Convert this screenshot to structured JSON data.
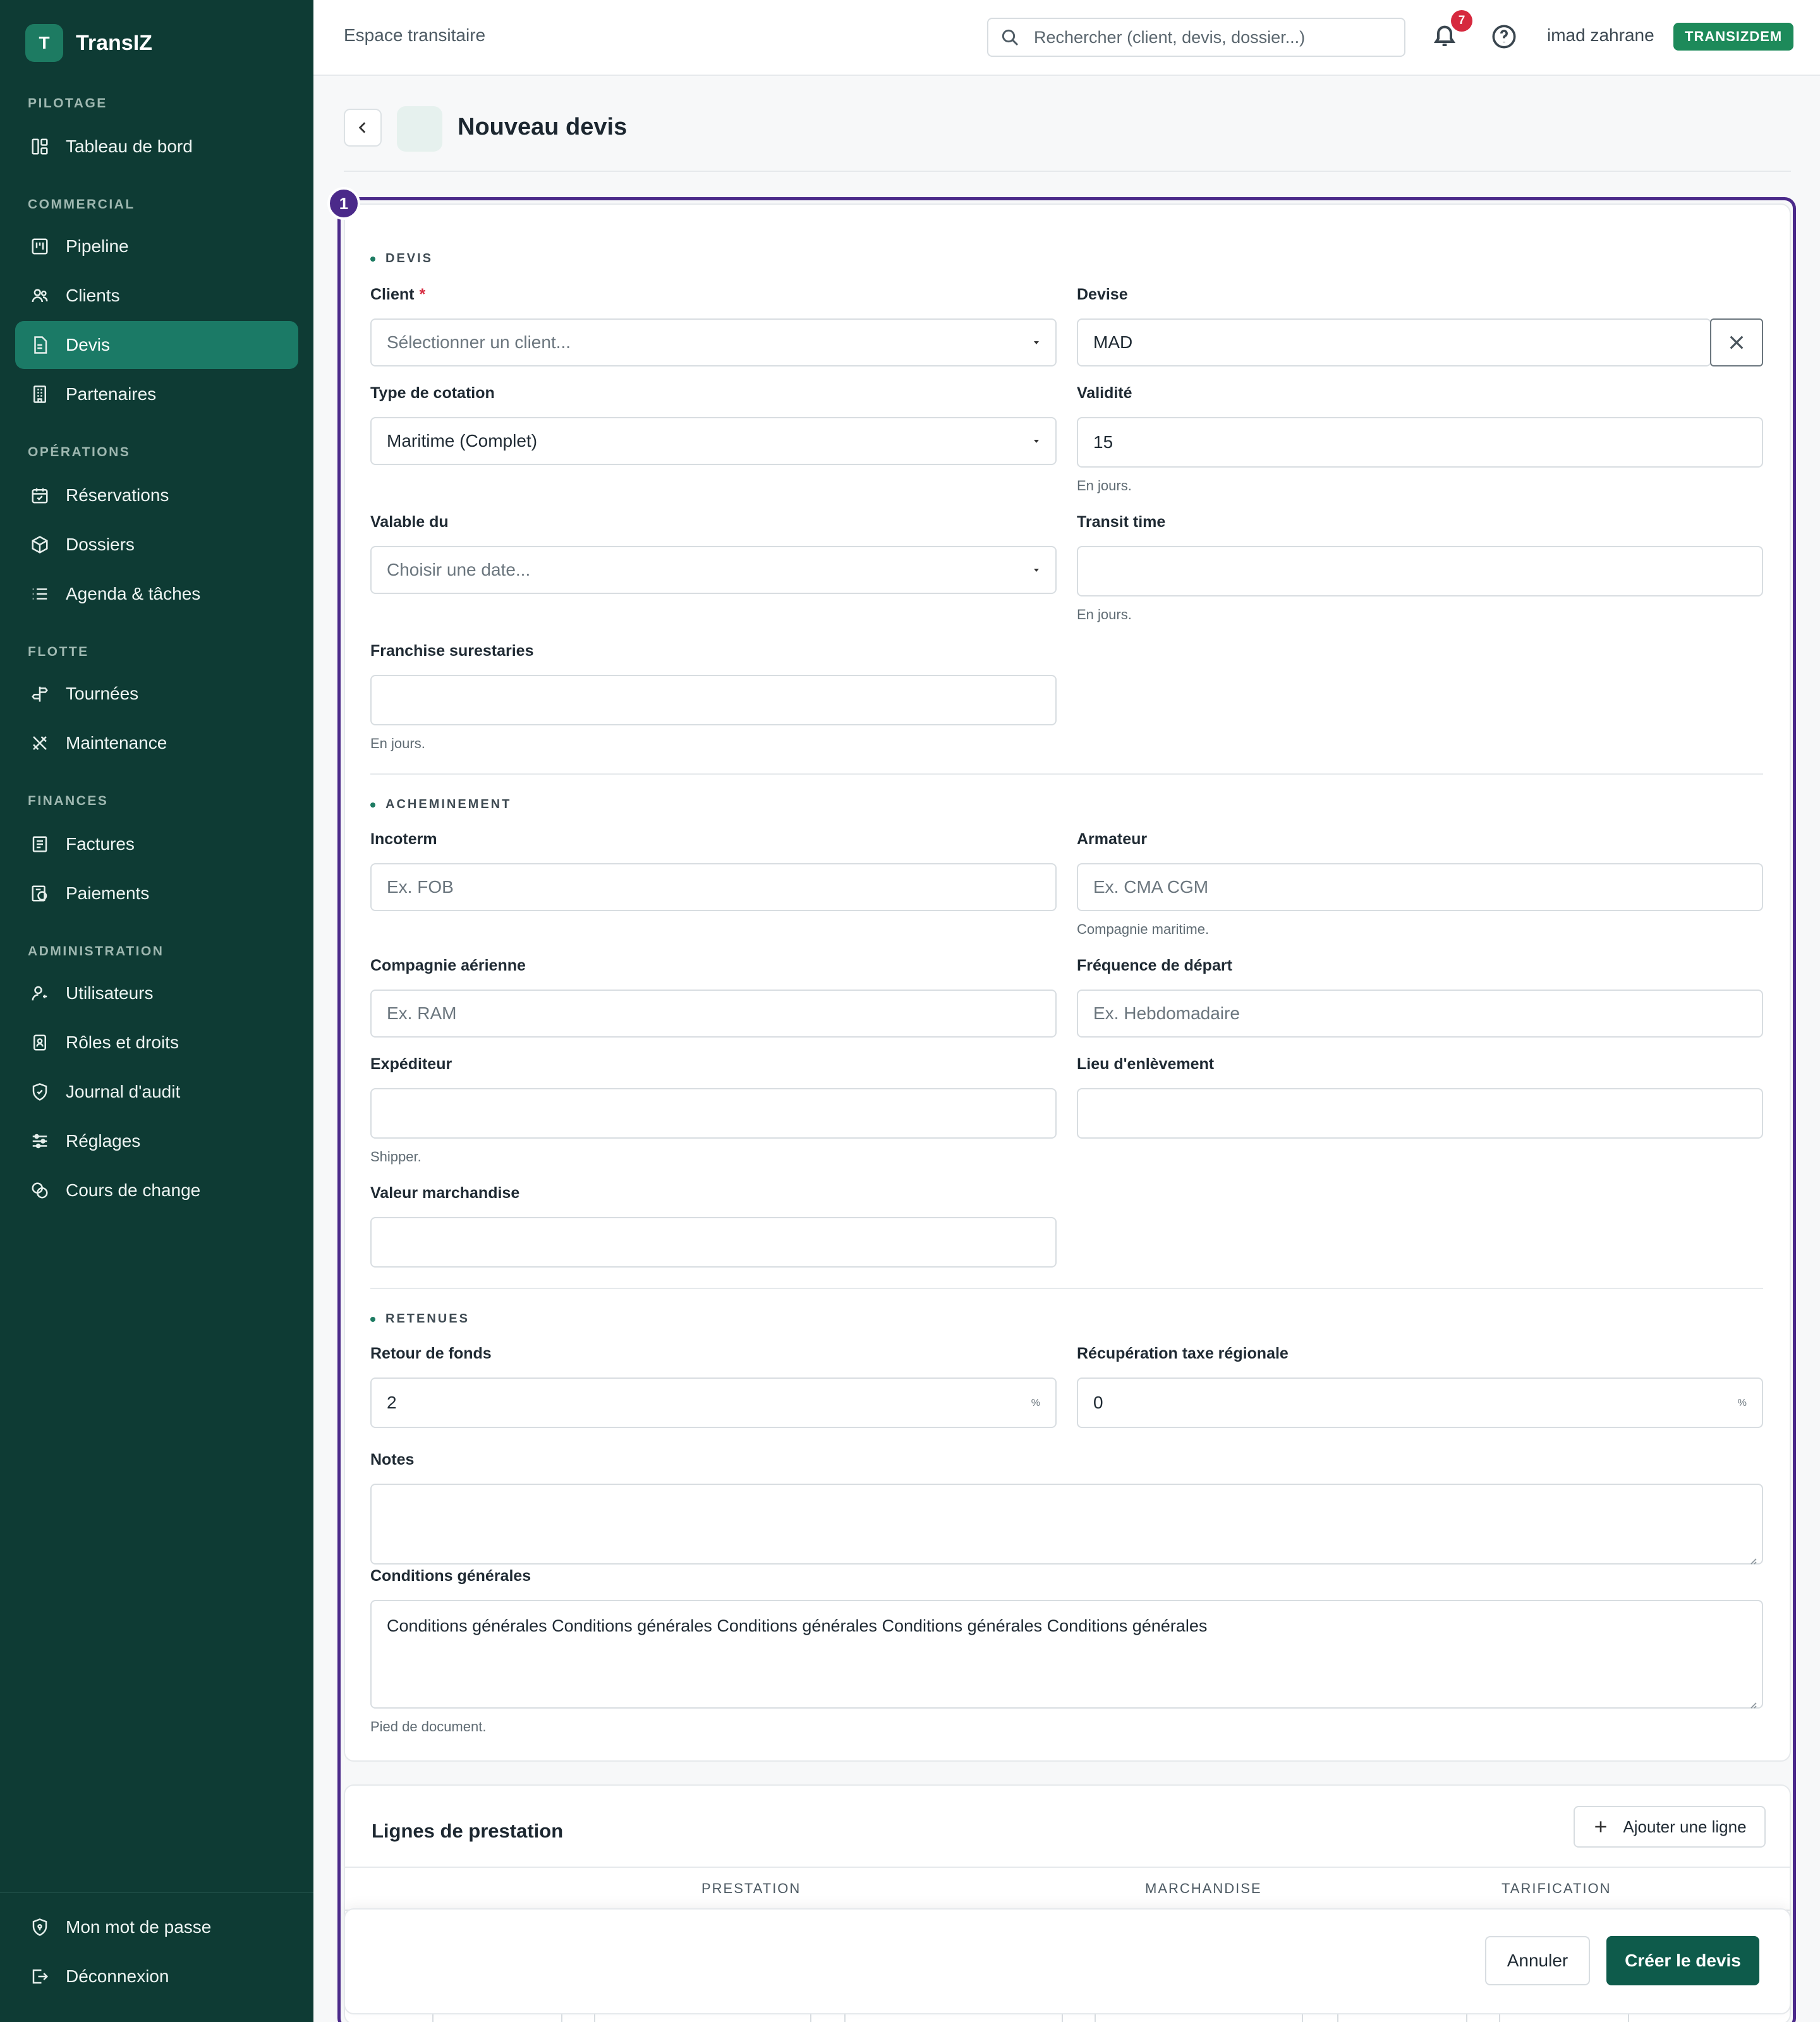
{
  "brand": {
    "initial": "T",
    "name": "TransIZ"
  },
  "sidebar": {
    "sections": [
      {
        "title": "PILOTAGE",
        "items": [
          {
            "label": "Tableau de bord",
            "icon": "dashboard-icon"
          }
        ]
      },
      {
        "title": "COMMERCIAL",
        "items": [
          {
            "label": "Pipeline",
            "icon": "pipeline-icon"
          },
          {
            "label": "Clients",
            "icon": "users-icon"
          },
          {
            "label": "Devis",
            "icon": "file-icon",
            "active": true
          },
          {
            "label": "Partenaires",
            "icon": "building-icon"
          }
        ]
      },
      {
        "title": "OPÉRATIONS",
        "items": [
          {
            "label": "Réservations",
            "icon": "calendar-check-icon"
          },
          {
            "label": "Dossiers",
            "icon": "package-icon"
          },
          {
            "label": "Agenda & tâches",
            "icon": "list-icon"
          }
        ]
      },
      {
        "title": "FLOTTE",
        "items": [
          {
            "label": "Tournées",
            "icon": "signpost-icon"
          },
          {
            "label": "Maintenance",
            "icon": "tools-icon"
          }
        ]
      },
      {
        "title": "FINANCES",
        "items": [
          {
            "label": "Factures",
            "icon": "invoice-icon"
          },
          {
            "label": "Paiements",
            "icon": "payment-icon"
          }
        ]
      },
      {
        "title": "ADMINISTRATION",
        "items": [
          {
            "label": "Utilisateurs",
            "icon": "user-key-icon"
          },
          {
            "label": "Rôles et droits",
            "icon": "badge-icon"
          },
          {
            "label": "Journal d'audit",
            "icon": "shield-icon"
          },
          {
            "label": "Réglages",
            "icon": "sliders-icon"
          },
          {
            "label": "Cours de change",
            "icon": "coins-icon"
          }
        ]
      }
    ],
    "bottom": [
      {
        "label": "Mon mot de passe",
        "icon": "shield-lock-icon"
      },
      {
        "label": "Déconnexion",
        "icon": "logout-icon"
      }
    ]
  },
  "topbar": {
    "crumb": "Espace transitaire",
    "search_placeholder": "Rechercher (client, devis, dossier...)",
    "notification_count": "7",
    "username": "imad zahrane",
    "tenant": "TRANSIZDEM"
  },
  "page": {
    "title": "Nouveau devis",
    "step": "1"
  },
  "form": {
    "devis": {
      "section": "DEVIS",
      "client_label": "Client",
      "client_placeholder": "Sélectionner un client...",
      "devise_label": "Devise",
      "devise_value": "MAD",
      "type_label": "Type de cotation",
      "type_value": "Maritime (Complet)",
      "validite_label": "Validité",
      "validite_value": "15",
      "validite_hint": "En jours.",
      "valable_label": "Valable du",
      "valable_placeholder": "Choisir une date...",
      "transit_label": "Transit time",
      "transit_hint": "En jours.",
      "franchise_label": "Franchise surestaries",
      "franchise_hint": "En jours."
    },
    "acheminement": {
      "section": "ACHEMINEMENT",
      "incoterm_label": "Incoterm",
      "incoterm_placeholder": "Ex. FOB",
      "armateur_label": "Armateur",
      "armateur_placeholder": "Ex. CMA CGM",
      "armateur_hint": "Compagnie maritime.",
      "compagnie_label": "Compagnie aérienne",
      "compagnie_placeholder": "Ex. RAM",
      "frequence_label": "Fréquence de départ",
      "frequence_placeholder": "Ex. Hebdomadaire",
      "expediteur_label": "Expéditeur",
      "expediteur_hint": "Shipper.",
      "lieu_label": "Lieu d'enlèvement",
      "valeur_label": "Valeur marchandise"
    },
    "retenues": {
      "section": "RETENUES",
      "retour_label": "Retour de fonds",
      "retour_value": "2",
      "retour_unit": "%",
      "recup_label": "Récupération taxe régionale",
      "recup_value": "0",
      "recup_unit": "%",
      "notes_label": "Notes",
      "conditions_label": "Conditions générales",
      "conditions_value": "Conditions générales Conditions générales Conditions générales Conditions générales Conditions générales",
      "conditions_hint": "Pied de document."
    }
  },
  "lines": {
    "title": "Lignes de prestation",
    "add_label": "Ajouter une ligne",
    "columns": [
      "PRESTATION",
      "MARCHANDISE",
      "TARIFICATION"
    ]
  },
  "footer": {
    "cancel": "Annuler",
    "create": "Créer le devis"
  },
  "colors": {
    "sidebar": "#0e3b34",
    "accent": "#1b7a66",
    "highlight": "#4b2a8a",
    "badge": "#1d8a5a",
    "danger": "#d6293e"
  }
}
